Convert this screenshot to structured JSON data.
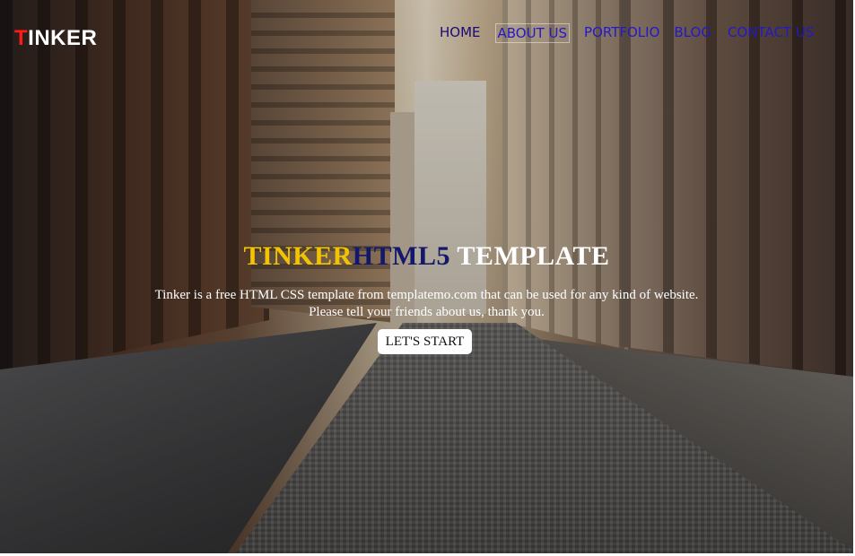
{
  "brand": {
    "first_letter": "T",
    "rest": "INKER"
  },
  "nav": {
    "items": [
      {
        "label": "HOME"
      },
      {
        "label": "ABOUT US"
      },
      {
        "label": "PORTFOLIO"
      },
      {
        "label": "BLOG"
      },
      {
        "label": "CONTACT US"
      }
    ]
  },
  "hero": {
    "title_part1": "TINKER",
    "title_part2": "HTML5",
    "title_part3": " TEMPLATE",
    "description_line1": "Tinker is a free HTML CSS template from templatemo.com that can be used for any kind of website.",
    "description_line2": "Please tell your friends about us, thank you.",
    "cta_label": "LET'S START"
  },
  "colors": {
    "brand_accent": "#ff1a1a",
    "nav_link": "#2418c8",
    "title_yellow": "#f2c300",
    "title_navy": "#14186a"
  }
}
